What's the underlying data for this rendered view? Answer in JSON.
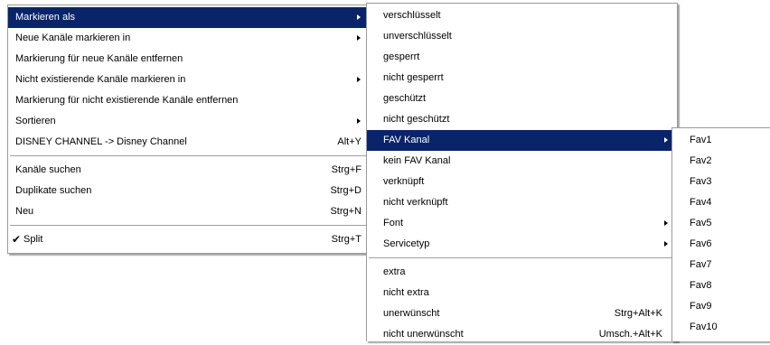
{
  "main_menu": {
    "items": [
      {
        "label": "Markieren als",
        "shortcut": "",
        "submenu": true,
        "highlighted": true
      },
      {
        "label": "Neue Kanäle markieren in",
        "shortcut": "",
        "submenu": true
      },
      {
        "label": "Markierung für neue Kanäle entfernen",
        "shortcut": "",
        "submenu": false
      },
      {
        "label": "Nicht existierende Kanäle markieren in",
        "shortcut": "",
        "submenu": true
      },
      {
        "label": "Markierung für nicht existierende Kanäle entfernen",
        "shortcut": "",
        "submenu": false
      },
      {
        "label": "Sortieren",
        "shortcut": "",
        "submenu": true
      },
      {
        "label": "DISNEY CHANNEL -> Disney Channel",
        "shortcut": "Alt+Y",
        "submenu": false
      },
      {
        "label": "Kanäle suchen",
        "shortcut": "Strg+F",
        "submenu": false
      },
      {
        "label": "Duplikate suchen",
        "shortcut": "Strg+D",
        "submenu": false
      },
      {
        "label": "Neu",
        "shortcut": "Strg+N",
        "submenu": false
      },
      {
        "label": "Split",
        "shortcut": "Strg+T",
        "submenu": false,
        "checked": true
      }
    ],
    "check_mark": "✔"
  },
  "mark_as_submenu": {
    "items": [
      {
        "label": "verschlüsselt",
        "shortcut": ""
      },
      {
        "label": "unverschlüsselt",
        "shortcut": ""
      },
      {
        "label": "gesperrt",
        "shortcut": ""
      },
      {
        "label": "nicht gesperrt",
        "shortcut": ""
      },
      {
        "label": "geschützt",
        "shortcut": ""
      },
      {
        "label": "nicht geschützt",
        "shortcut": ""
      },
      {
        "label": "FAV Kanal",
        "shortcut": "",
        "submenu": true,
        "highlighted": true
      },
      {
        "label": "kein FAV Kanal",
        "shortcut": ""
      },
      {
        "label": "verknüpft",
        "shortcut": ""
      },
      {
        "label": "nicht verknüpft",
        "shortcut": ""
      },
      {
        "label": "Font",
        "shortcut": "",
        "submenu": true
      },
      {
        "label": "Servicetyp",
        "shortcut": "",
        "submenu": true
      },
      {
        "label": "extra",
        "shortcut": ""
      },
      {
        "label": "nicht extra",
        "shortcut": ""
      },
      {
        "label": "unerwünscht",
        "shortcut": "Strg+Alt+K"
      },
      {
        "label": "nicht unerwünscht",
        "shortcut": "Umsch.+Alt+K"
      }
    ]
  },
  "fav_submenu": {
    "items": [
      "Fav1",
      "Fav2",
      "Fav3",
      "Fav4",
      "Fav5",
      "Fav6",
      "Fav7",
      "Fav8",
      "Fav9",
      "Fav10"
    ]
  },
  "colors": {
    "highlight_bg": "#0a246a",
    "highlight_text": "#ffffff",
    "menu_bg": "#ffffff",
    "border": "#9a9a9a"
  }
}
